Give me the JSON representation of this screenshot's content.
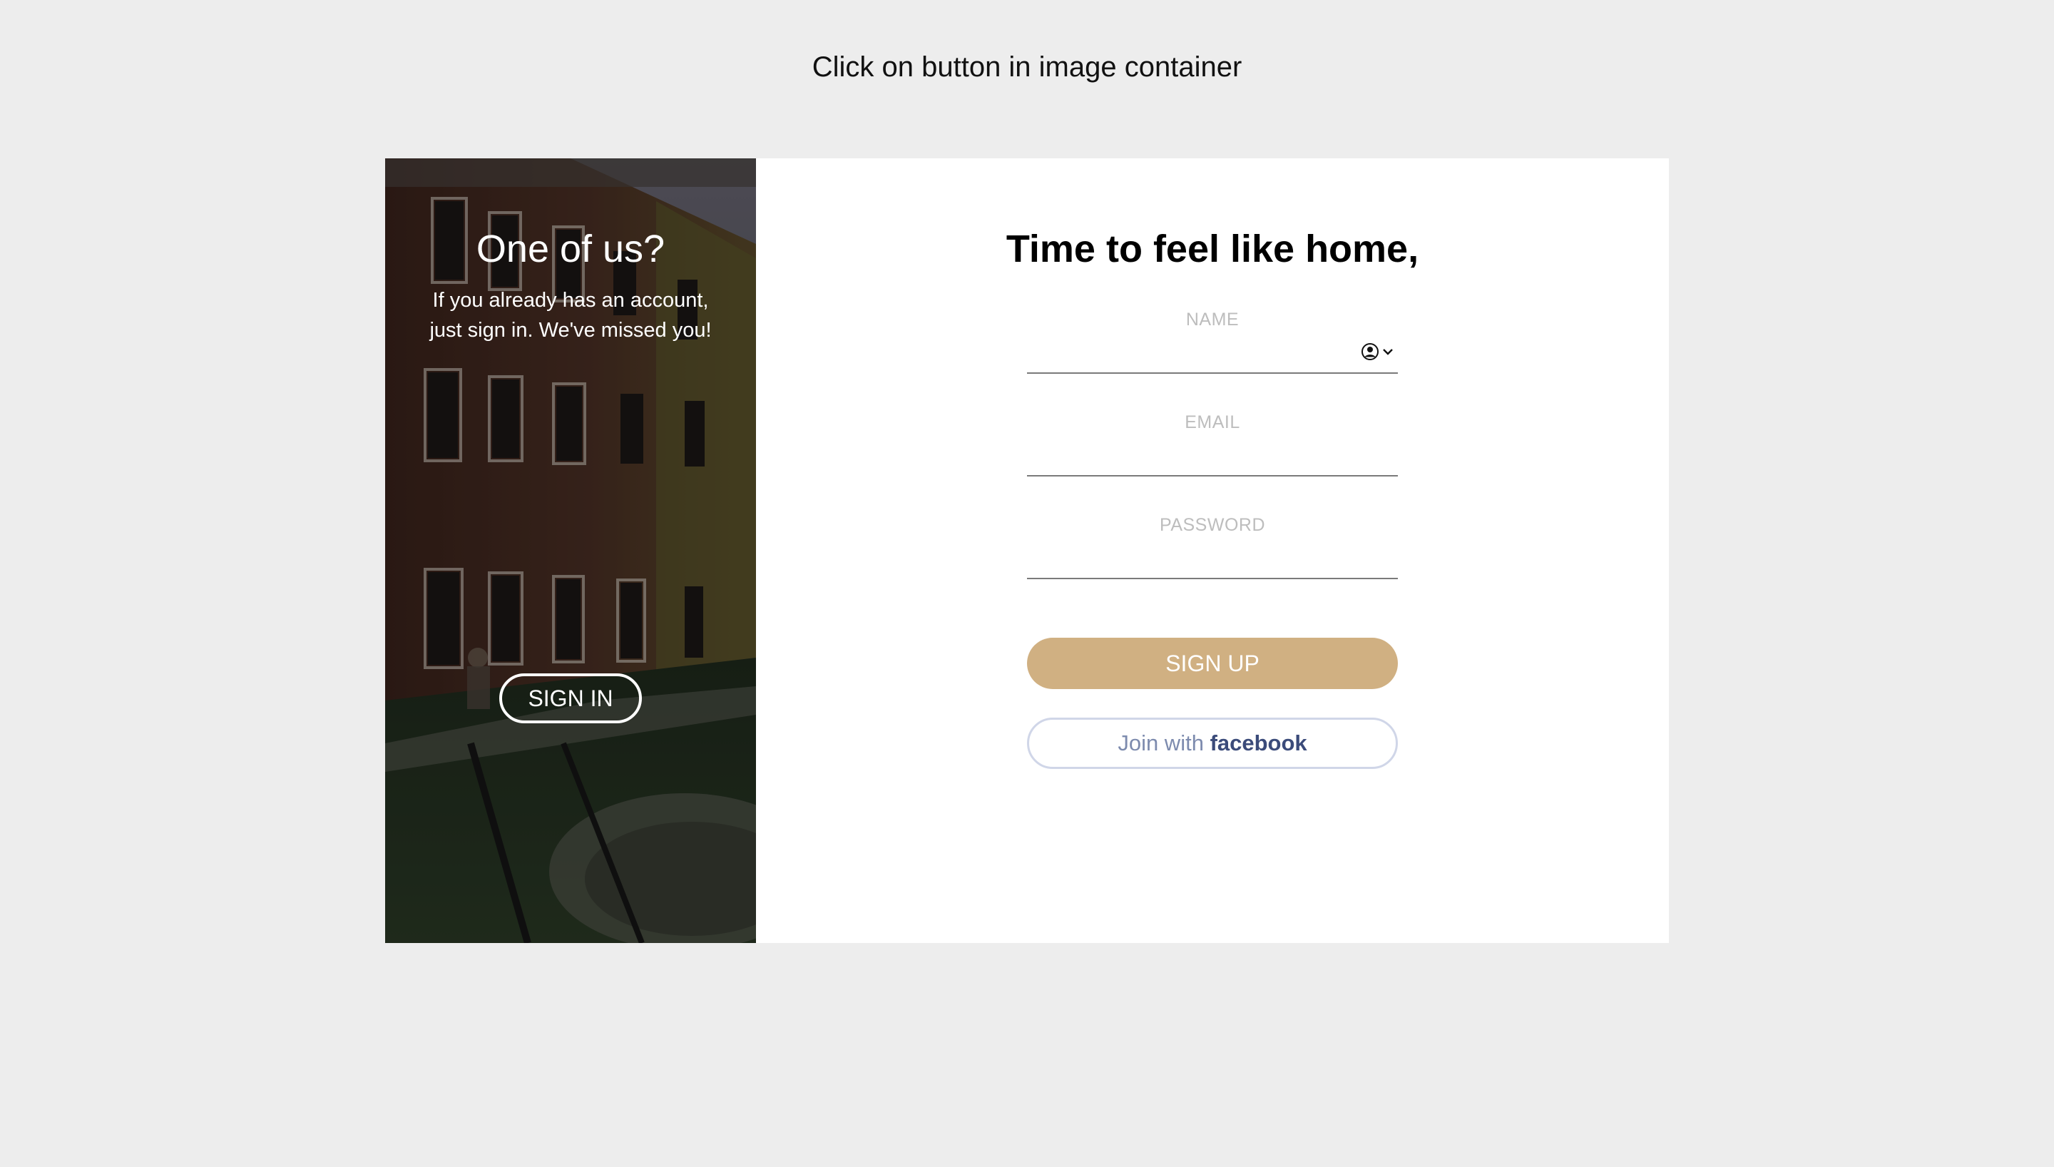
{
  "instruction": "Click on button in image container",
  "image_panel": {
    "title": "One of us?",
    "text": "If you already has an account, just sign in. We've missed you!",
    "signin_label": "SIGN IN"
  },
  "form": {
    "title": "Time to feel like home,",
    "name_label": "NAME",
    "email_label": "EMAIL",
    "password_label": "PASSWORD",
    "name_value": "",
    "email_value": "",
    "password_value": "",
    "signup_label": "SIGN UP",
    "facebook_prefix": "Join with",
    "facebook_brand": "facebook"
  },
  "colors": {
    "page_background": "#ededed",
    "signup_button": "#d0b082",
    "facebook_text": "#3b4b7a"
  },
  "icons": {
    "autofill": "contact-autofill-icon"
  }
}
